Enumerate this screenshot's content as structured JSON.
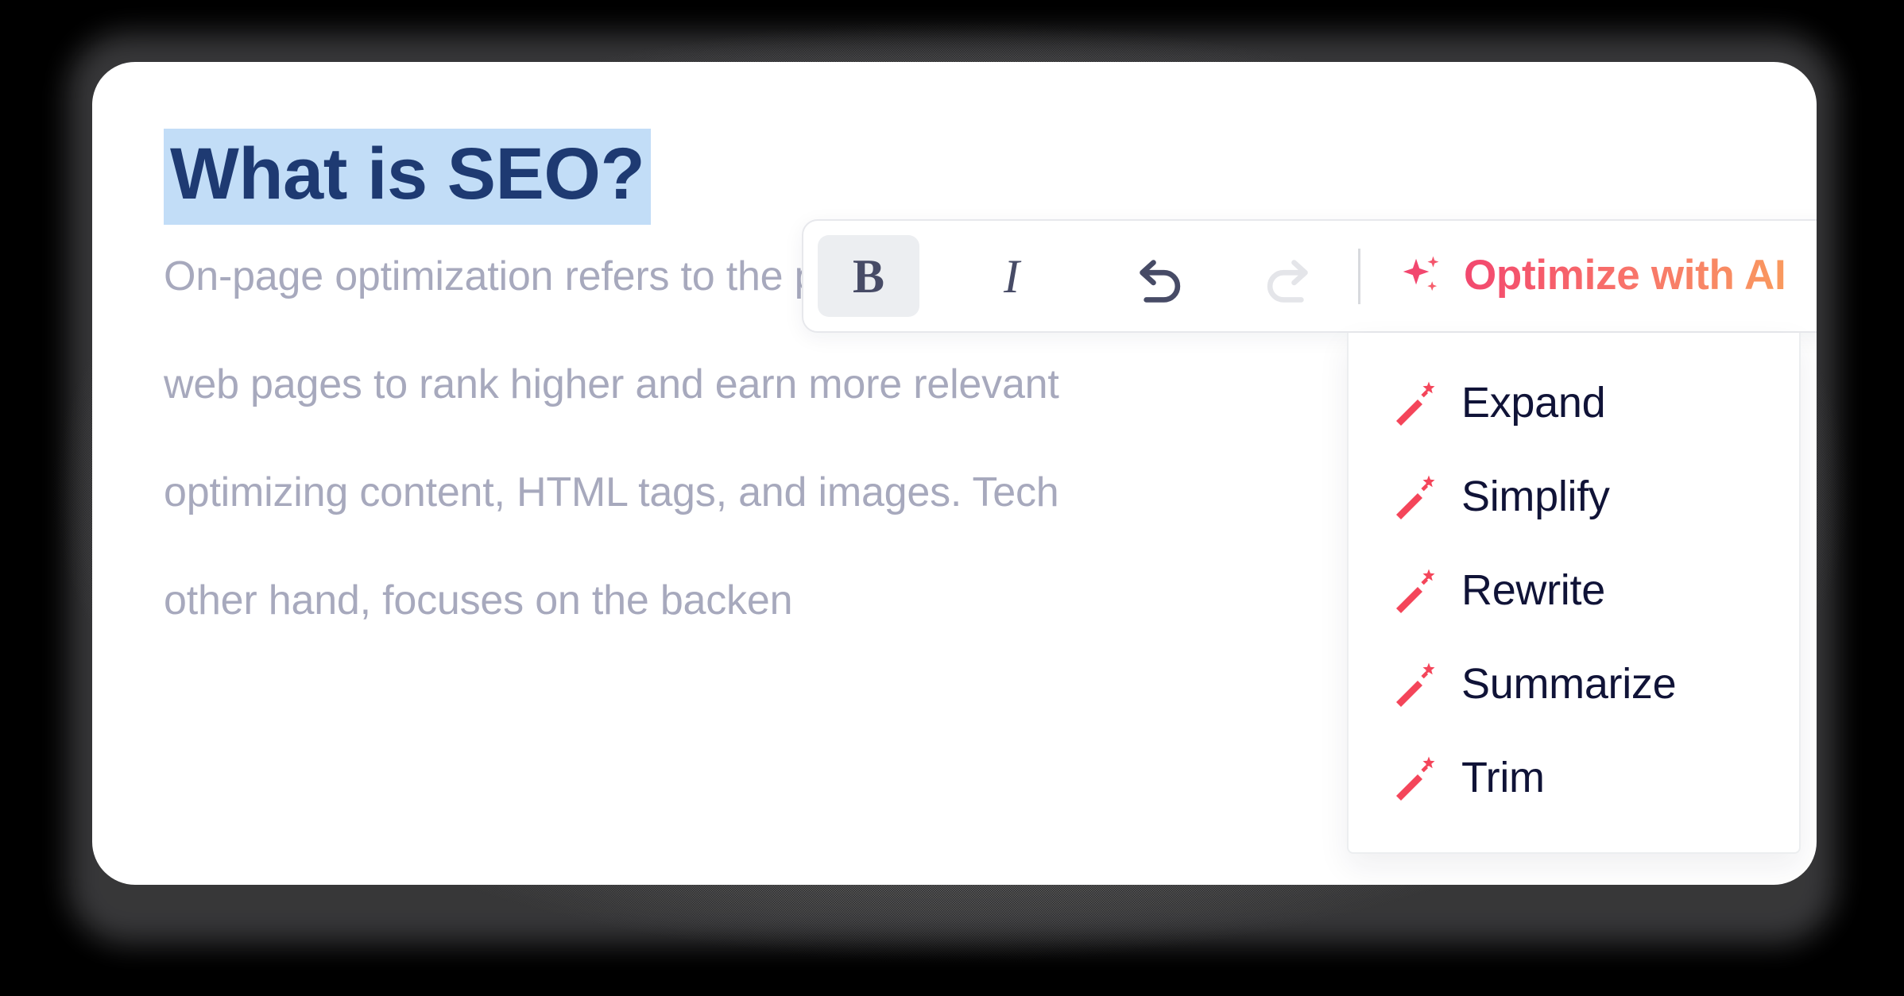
{
  "document": {
    "title": "What is SEO?",
    "title_selected": true,
    "body_lines": [
      "On-page optimization refers to the practices that o",
      "web pages to rank higher and earn more relevant",
      "optimizing content, HTML tags, and images. Tech",
      "other hand, focuses on the backen"
    ]
  },
  "toolbar": {
    "bold_label": "B",
    "bold_active": true,
    "italic_label": "I",
    "undo_name": "undo-icon",
    "redo_name": "redo-icon",
    "redo_disabled": true,
    "ai_button_label": "Optimize with AI",
    "ai_icon_name": "sparkle-icon"
  },
  "ai_menu": {
    "open": true,
    "items": [
      {
        "label": "Expand",
        "icon": "magic-wand-icon"
      },
      {
        "label": "Simplify",
        "icon": "magic-wand-icon"
      },
      {
        "label": "Rewrite",
        "icon": "magic-wand-icon"
      },
      {
        "label": "Summarize",
        "icon": "magic-wand-icon"
      },
      {
        "label": "Trim",
        "icon": "magic-wand-icon"
      }
    ]
  },
  "colors": {
    "selection_highlight": "#c2ddf7",
    "title_text": "#1e3a72",
    "body_text": "#a7a9bd",
    "ai_gradient_start": "#f2476f",
    "ai_gradient_end": "#f99a5e",
    "wand_red": "#f4455a",
    "menu_text": "#101337",
    "toolbar_border": "#e7e8ec",
    "bold_active_bg": "#eceef1",
    "card_bg": "#ffffff",
    "page_bg": "#000000"
  }
}
